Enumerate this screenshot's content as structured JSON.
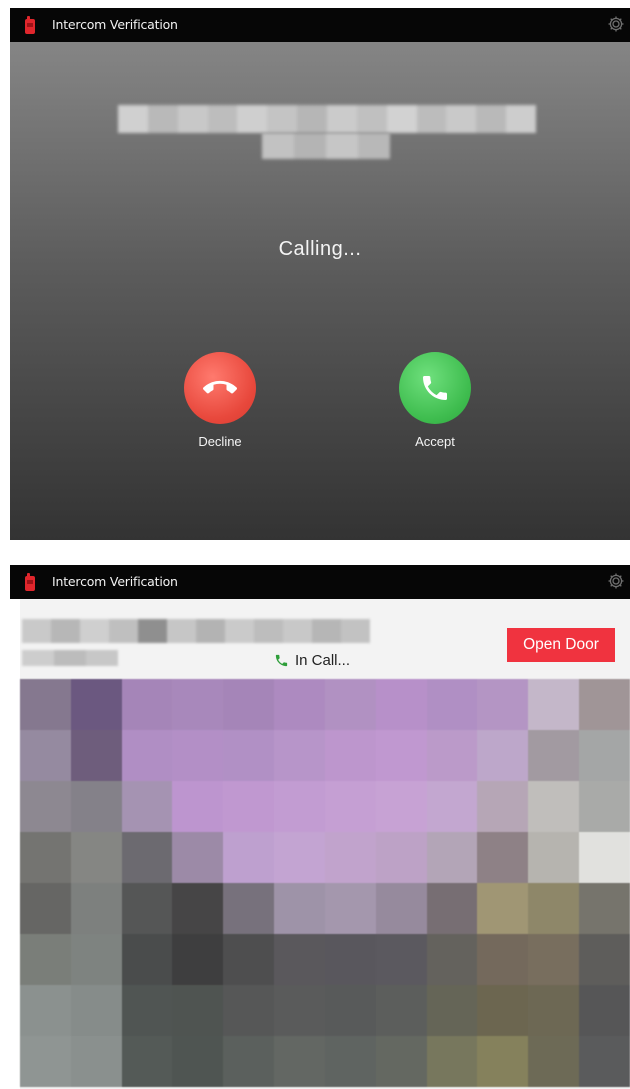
{
  "incoming_window": {
    "title": "Intercom Verification",
    "status": "Calling...",
    "decline_label": "Decline",
    "accept_label": "Accept",
    "icons": {
      "app": "intercom-app-icon",
      "settings": "gear-icon",
      "decline": "phone-hangup-icon",
      "accept": "phone-icon"
    },
    "colors": {
      "decline": "#e8483c",
      "accept": "#3fbd4f"
    }
  },
  "incall_window": {
    "title": "Intercom Verification",
    "status": "In Call...",
    "open_door_label": "Open Door",
    "icons": {
      "app": "intercom-app-icon",
      "settings": "gear-icon",
      "status": "phone-icon"
    },
    "colors": {
      "open_door": "#f0333f",
      "status_icon": "#2e9e3a"
    }
  }
}
